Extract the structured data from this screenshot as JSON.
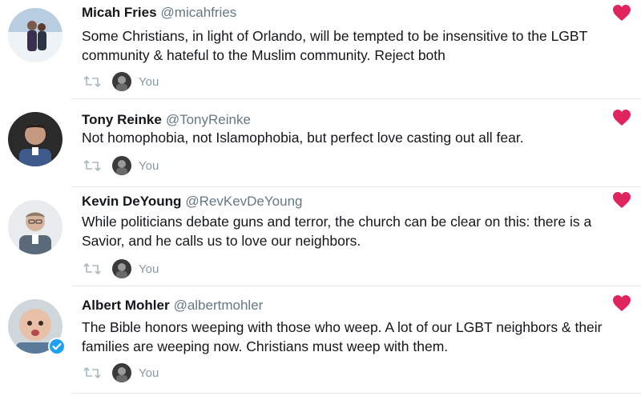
{
  "colors": {
    "heart": "#e0245e",
    "handle": "#657786",
    "muted": "#8899a6",
    "verified": "#1da1f2",
    "divider": "#e1e8ed"
  },
  "icons": {
    "like": "heart-icon",
    "retweet": "retweet-icon",
    "verified": "verified-badge-icon"
  },
  "tweets": [
    {
      "name": "Micah Fries",
      "handle": "@micahfries",
      "text": "Some Christians, in light of Orlando, will be tempted to be insensitive to the LGBT community & hateful to the Muslim community. Reject both",
      "liked_by": "You",
      "liked": true
    },
    {
      "name": "Tony Reinke",
      "handle": "@TonyReinke",
      "text": "Not homophobia, not Islamophobia, but perfect love casting out all fear.",
      "liked_by": "You",
      "liked": true
    },
    {
      "name": "Kevin DeYoung",
      "handle": "@RevKevDeYoung",
      "text": "While politicians debate guns and terror, the church can be clear on this: there is a Savior, and he calls us to love our neighbors.",
      "liked_by": "You",
      "liked": true
    },
    {
      "name": "Albert Mohler",
      "handle": "@albertmohler",
      "text": "The Bible honors weeping with those who weep. A lot of our LGBT neighbors & their families are weeping now. Christians must weep with them.",
      "liked_by": "You",
      "liked": true,
      "verified": true
    }
  ]
}
